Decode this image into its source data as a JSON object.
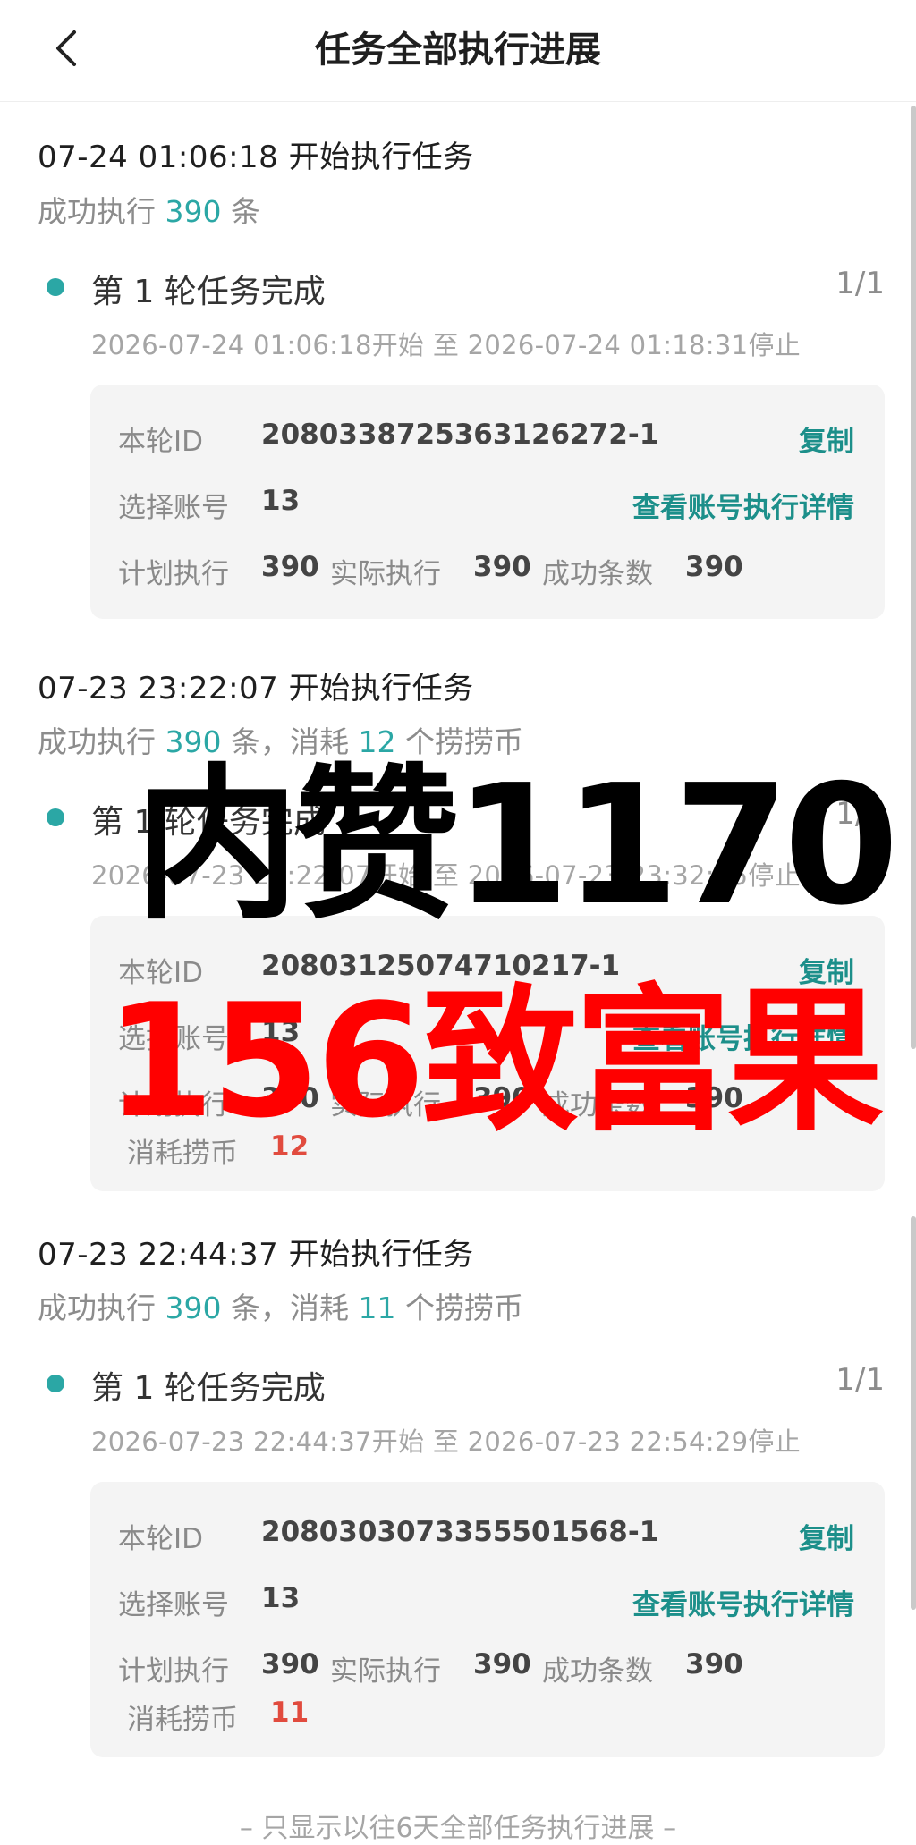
{
  "header": {
    "title": "任务全部执行进展"
  },
  "runs": [
    {
      "start": "07-24 01:06:18 开始执行任务",
      "success_prefix": "成功执行",
      "success_count": "390",
      "success_suffix": "条",
      "round_title": "第 1 轮任务完成",
      "round_count": "1/1",
      "round_time": "2026-07-24 01:06:18开始 至 2026-07-24 01:18:31停止",
      "id_label": "本轮ID",
      "id": "2080338725363126272-1",
      "copy": "复制",
      "account_label": "选择账号",
      "account": "13",
      "detail": "查看账号执行详情",
      "plan_label": "计划执行",
      "plan": "390",
      "actual_label": "实际执行",
      "actual": "390",
      "ok_label": "成功条数",
      "ok": "390"
    },
    {
      "start": "07-23 23:22:07 开始执行任务",
      "success_prefix": "成功执行",
      "success_count": "390",
      "success_mid": "条，消耗",
      "coin_count": "12",
      "coin_suffix": "个捞捞币",
      "round_title": "第 1 轮任务完成",
      "round_count": "1/1",
      "round_time": "2026-07-23 23:22:07开始 至 2026-07-23 23:32:25停止",
      "id_label": "本轮ID",
      "id": "20803125074710217-1",
      "copy": "复制",
      "account_label": "选择账号",
      "account": "13",
      "detail": "查看账号执行详情",
      "plan_label": "计划执行",
      "plan": "390",
      "actual_label": "实际执行",
      "actual": "390",
      "ok_label": "成功条数",
      "ok": "390",
      "cost_label": "消耗捞币",
      "cost": "12"
    },
    {
      "start": "07-23 22:44:37 开始执行任务",
      "success_prefix": "成功执行",
      "success_count": "390",
      "success_mid": "条，消耗",
      "coin_count": "11",
      "coin_suffix": "个捞捞币",
      "round_title": "第 1 轮任务完成",
      "round_count": "1/1",
      "round_time": "2026-07-23 22:44:37开始 至 2026-07-23 22:54:29停止",
      "id_label": "本轮ID",
      "id": "2080303073355501568-1",
      "copy": "复制",
      "account_label": "选择账号",
      "account": "13",
      "detail": "查看账号执行详情",
      "plan_label": "计划执行",
      "plan": "390",
      "actual_label": "实际执行",
      "actual": "390",
      "ok_label": "成功条数",
      "ok": "390",
      "cost_label": "消耗捞币",
      "cost": "11"
    }
  ],
  "footer": "– 只显示以往6天全部任务执行进展 –",
  "overlay": {
    "line1": "内赞1170",
    "line2": "156致富果"
  },
  "colors": {
    "accent": "#2ba7a5",
    "link": "#1c8f8a",
    "cost": "#e14b3e",
    "overlay_red": "#ff0000"
  },
  "icons": {
    "back": "chevron-left-icon"
  }
}
